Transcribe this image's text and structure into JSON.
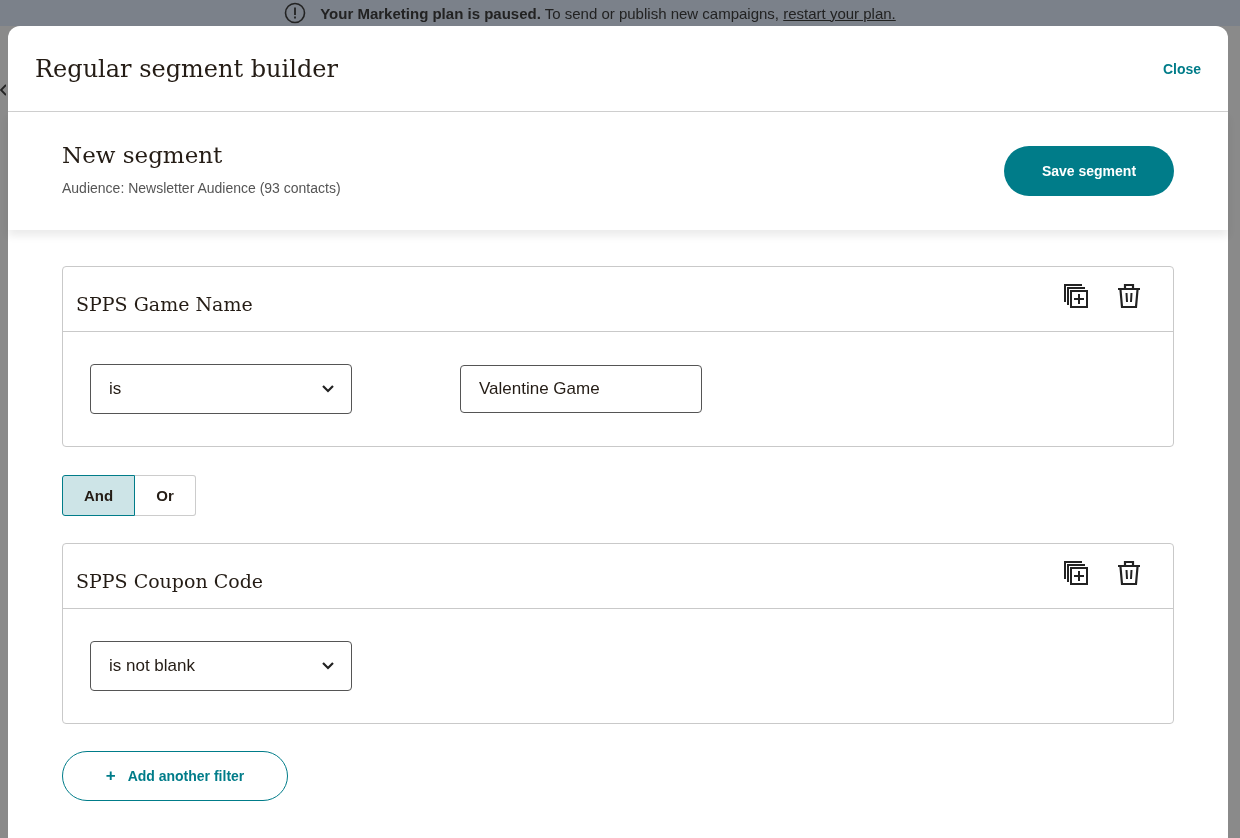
{
  "banner": {
    "message": "**Your Marketing plan is paused.** To send or publish new campaigns,",
    "link": "restart your plan."
  },
  "modal": {
    "title": "Regular segment builder",
    "close": "Close"
  },
  "segment": {
    "name": "New segment",
    "audience": "Audience: Newsletter Audience (93 contacts)",
    "save": "Save segment"
  },
  "filters": [
    {
      "title": "SPPS Game Name",
      "condition": "is",
      "value": "Valentine Game"
    },
    {
      "title": "SPPS Coupon Code",
      "condition": "is not blank"
    }
  ],
  "logic": [
    {
      "label": "And",
      "selected": true
    },
    {
      "label": "Or",
      "selected": false
    }
  ],
  "add_filter": {
    "icon": "+",
    "label": "Add another filter"
  }
}
